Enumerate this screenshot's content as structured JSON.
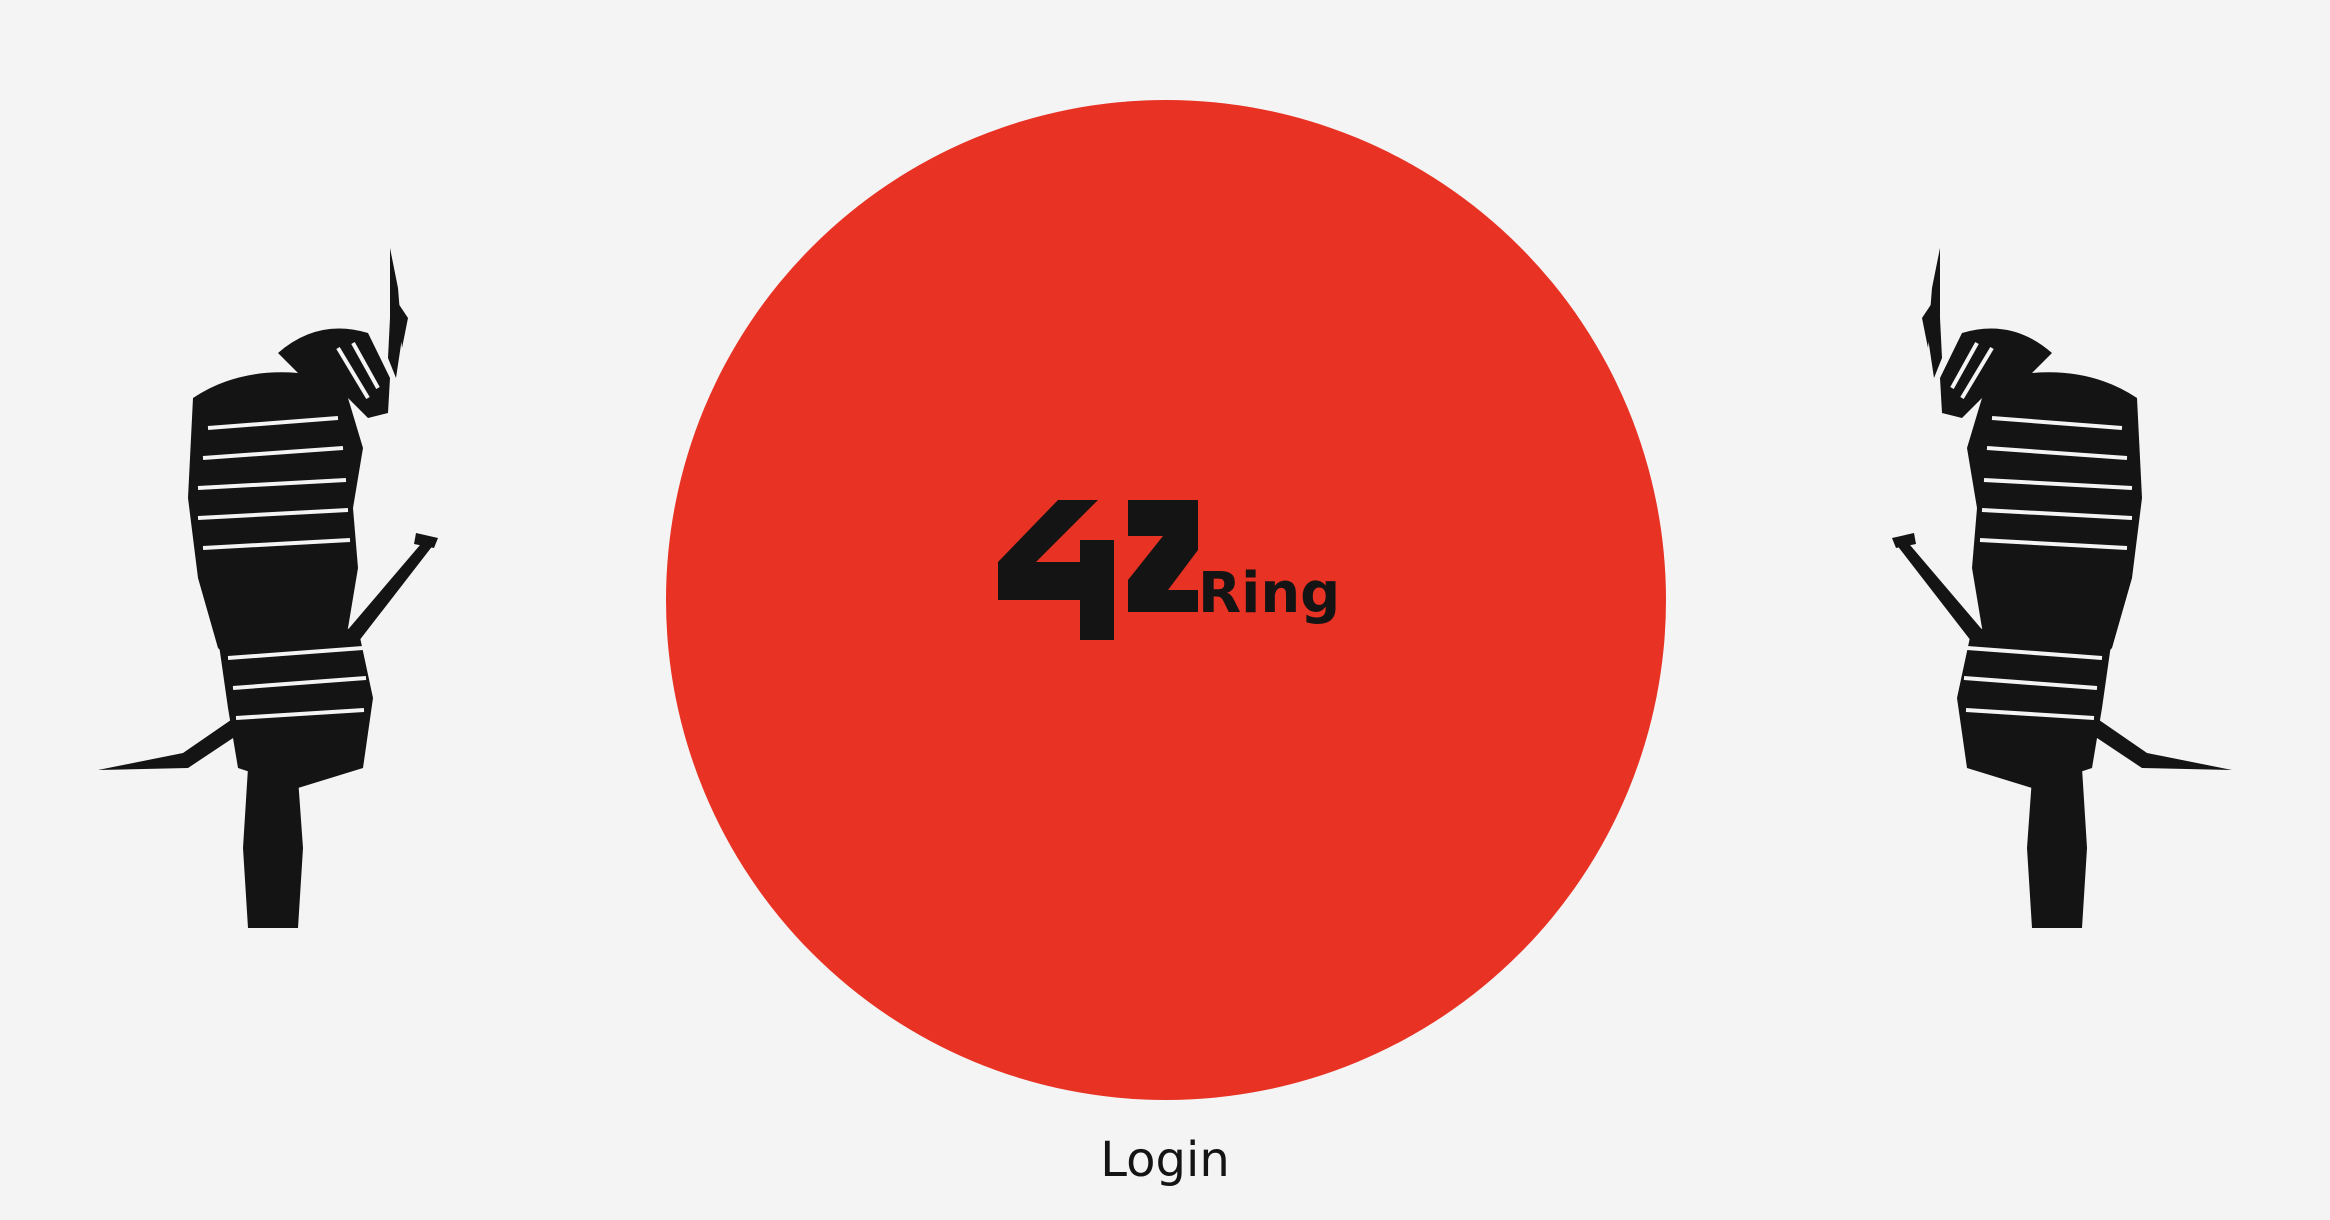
{
  "login": {
    "label": "Login"
  },
  "logo": {
    "number_text": "42",
    "brand_text": "Ring"
  },
  "colors": {
    "background": "#f4f4f4",
    "sun": "#e83224",
    "ink": "#141414"
  },
  "icons": {
    "left_figure": "samurai-icon",
    "right_figure": "samurai-icon"
  }
}
